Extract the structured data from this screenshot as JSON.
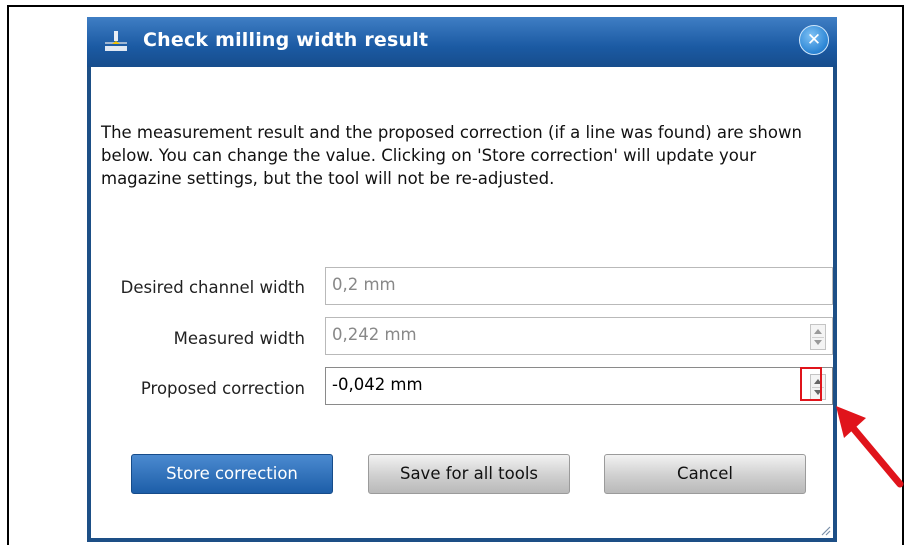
{
  "dialog": {
    "title": "Check milling width result",
    "close_label": "✕",
    "description": "The measurement result and the proposed correction (if a line was found) are shown below. You can change the value. Clicking on 'Store correction' will update your magazine settings, but the tool will not be re-adjusted."
  },
  "fields": {
    "desired_label": "Desired channel width",
    "desired_value": "0,2 mm",
    "measured_label": "Measured width",
    "measured_value": "0,242 mm",
    "correction_label": "Proposed correction",
    "correction_value": "-0,042 mm"
  },
  "buttons": {
    "store": "Store correction",
    "save_all": "Save for all tools",
    "cancel": "Cancel"
  },
  "colors": {
    "title_bar": "#1b5aa3",
    "primary_button": "#1d5ea8",
    "highlight": "#e0141b",
    "annotation_arrow": "#e0141b"
  },
  "icons": {
    "title": "milling-tool-icon",
    "close": "close-icon",
    "spinner": "spinner-arrows-icon",
    "annotation": "red-arrow-icon"
  }
}
